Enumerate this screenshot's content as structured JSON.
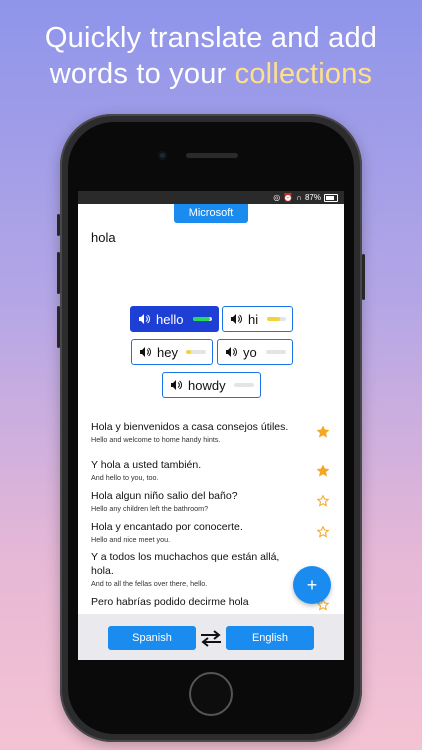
{
  "headline": {
    "line1": "Quickly translate and add",
    "line2_prefix": "words to your ",
    "line2_highlight": "collections"
  },
  "status_bar": {
    "battery": "87%",
    "icons": [
      "location-icon",
      "alarm-icon",
      "headphones-icon",
      "battery-icon"
    ]
  },
  "translator": {
    "engine": "Microsoft",
    "source_word": "hola",
    "translations": [
      {
        "word": "hello",
        "confidence": 0.9,
        "color": "#22dd55",
        "selected": true
      },
      {
        "word": "hi",
        "confidence": 0.7,
        "color": "#f2d43a",
        "selected": false
      },
      {
        "word": "hey",
        "confidence": 0.25,
        "color": "#f2d43a",
        "selected": false
      },
      {
        "word": "yo",
        "confidence": 0.0,
        "color": "#e4e4e4",
        "selected": false
      },
      {
        "word": "howdy",
        "confidence": 0.0,
        "color": "#e4e4e4",
        "selected": false
      }
    ]
  },
  "examples": [
    {
      "es": "Hola y bienvenidos a casa consejos útiles.",
      "en": "Hello and welcome to home handy hints.",
      "starred": true
    },
    {
      "es": "Y hola a usted también.",
      "en": "And hello to you, too.",
      "starred": true
    },
    {
      "es": "Hola algun niño salio del baño?",
      "en": "Hello any children left the bathroom?",
      "starred": false
    },
    {
      "es": "Hola y encantado por conocerte.",
      "en": "Hello and nice meet you.",
      "starred": false
    },
    {
      "es": "Y a todos los muchachos que están allá, hola.",
      "en": "And to all the fellas over there, hello.",
      "starred": false
    },
    {
      "es": "Pero habrías podido decirme hola",
      "en": "",
      "starred": false
    }
  ],
  "fab": {
    "label": "+"
  },
  "languages": {
    "source": "Spanish",
    "target": "English"
  },
  "colors": {
    "accent": "#1a8cf0",
    "selected_chip": "#1e3fd6",
    "star": "#f5a623"
  }
}
